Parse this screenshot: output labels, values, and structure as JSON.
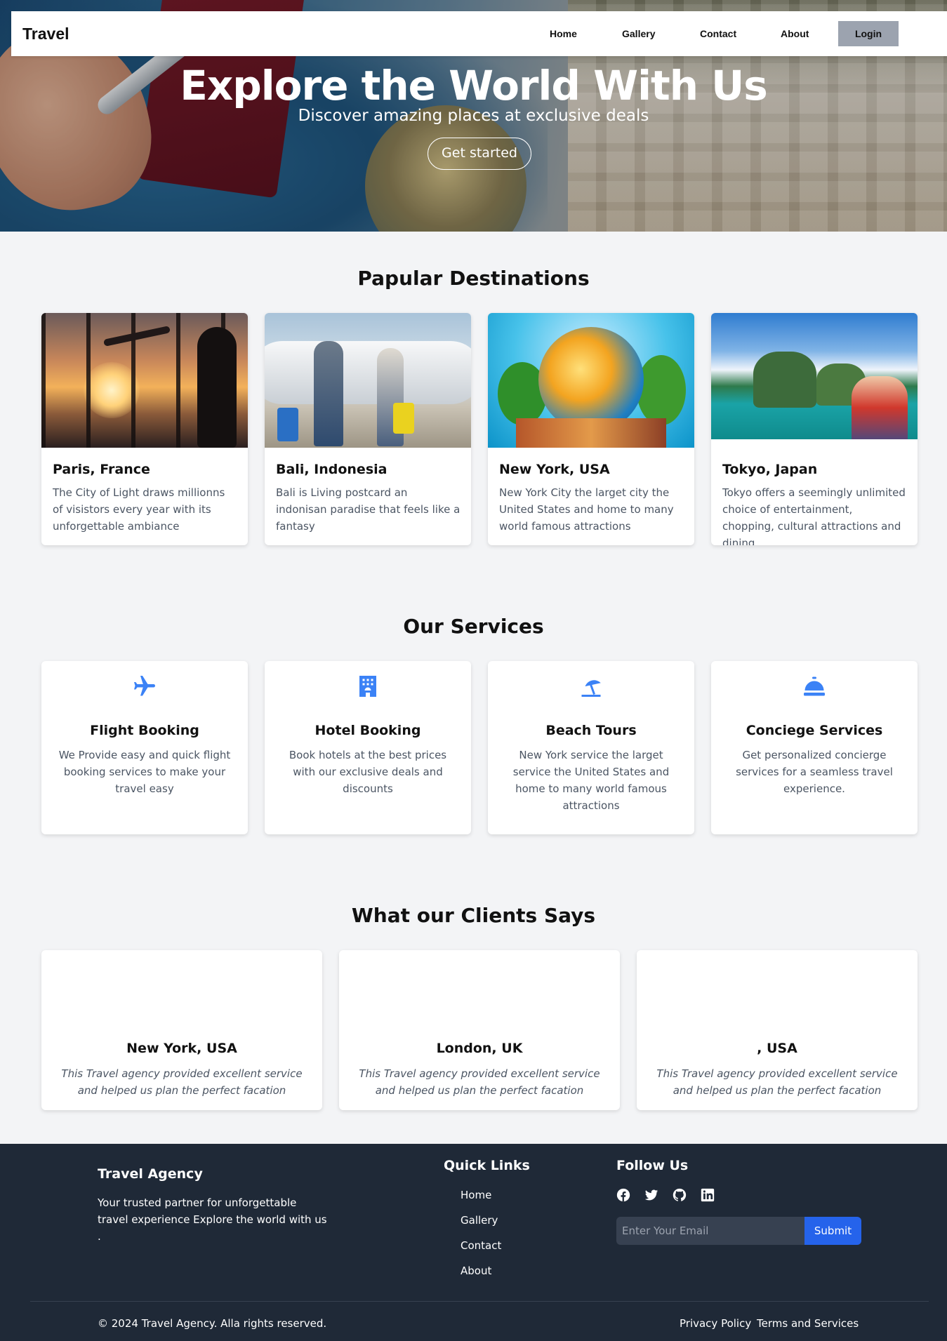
{
  "nav": {
    "brand": "Travel",
    "links": [
      "Home",
      "Gallery",
      "Contact",
      "About"
    ],
    "login_label": "Login"
  },
  "hero": {
    "title": "Explore the World With Us",
    "subtitle": "Discover amazing places at exclusive deals",
    "cta_label": "Get started"
  },
  "destinations": {
    "title": "Papular Destinations",
    "items": [
      {
        "name": "Paris, France",
        "description": "The City of Light draws millionns of visistors every year with its unforgettable ambiance"
      },
      {
        "name": "Bali, Indonesia",
        "description": "Bali is Living postcard an indonisan paradise that feels like a fantasy"
      },
      {
        "name": "New York, USA",
        "description": "New York City the larget city the United States and home to many world famous attractions"
      },
      {
        "name": "Tokyo, Japan",
        "description": "Tokyo offers a seemingly unlimited choice of entertainment, chopping, cultural attractions and dining"
      }
    ]
  },
  "services": {
    "title": "Our Services",
    "items": [
      {
        "icon": "plane-icon",
        "title": "Flight Booking",
        "description": "We Provide easy and quick flight booking services to make your travel easy"
      },
      {
        "icon": "hotel-icon",
        "title": "Hotel Booking",
        "description": "Book hotels at the best prices with our exclusive deals and discounts"
      },
      {
        "icon": "umbrella-beach-icon",
        "title": "Beach Tours",
        "description": "New York service the larget service the United States and home to many world famous attractions"
      },
      {
        "icon": "concierge-bell-icon",
        "title": "Conciege Services",
        "description": "Get personalized concierge services for a seamless travel experience."
      }
    ],
    "accent_color": "#3b82f6"
  },
  "testimonials": {
    "title": "What our Clients Says",
    "items": [
      {
        "location": "New York, USA",
        "quote": "This Travel agency provided excellent service and helped us plan the perfect facation"
      },
      {
        "location": "London, UK",
        "quote": "This Travel agency provided excellent service and helped us plan the perfect facation"
      },
      {
        "location": ", USA",
        "quote": "This Travel agency provided excellent service and helped us plan the perfect facation"
      }
    ]
  },
  "footer": {
    "brand": "Travel Agency",
    "about": "Your trusted partner for unforgettable travel experience Explore the world with us .",
    "quick_links_title": "Quick Links",
    "quick_links": [
      "Home",
      "Gallery",
      "Contact",
      "About"
    ],
    "follow_title": "Follow Us",
    "social_icons": [
      "facebook-icon",
      "twitter-icon",
      "github-icon",
      "linkedin-icon"
    ],
    "email_placeholder": "Enter Your Email",
    "submit_label": "Submit",
    "copyright": "© 2024 Travel Agency. Alla rights reserved.",
    "bottom_links": [
      "Privacy Policy",
      "Terms and Services"
    ]
  }
}
